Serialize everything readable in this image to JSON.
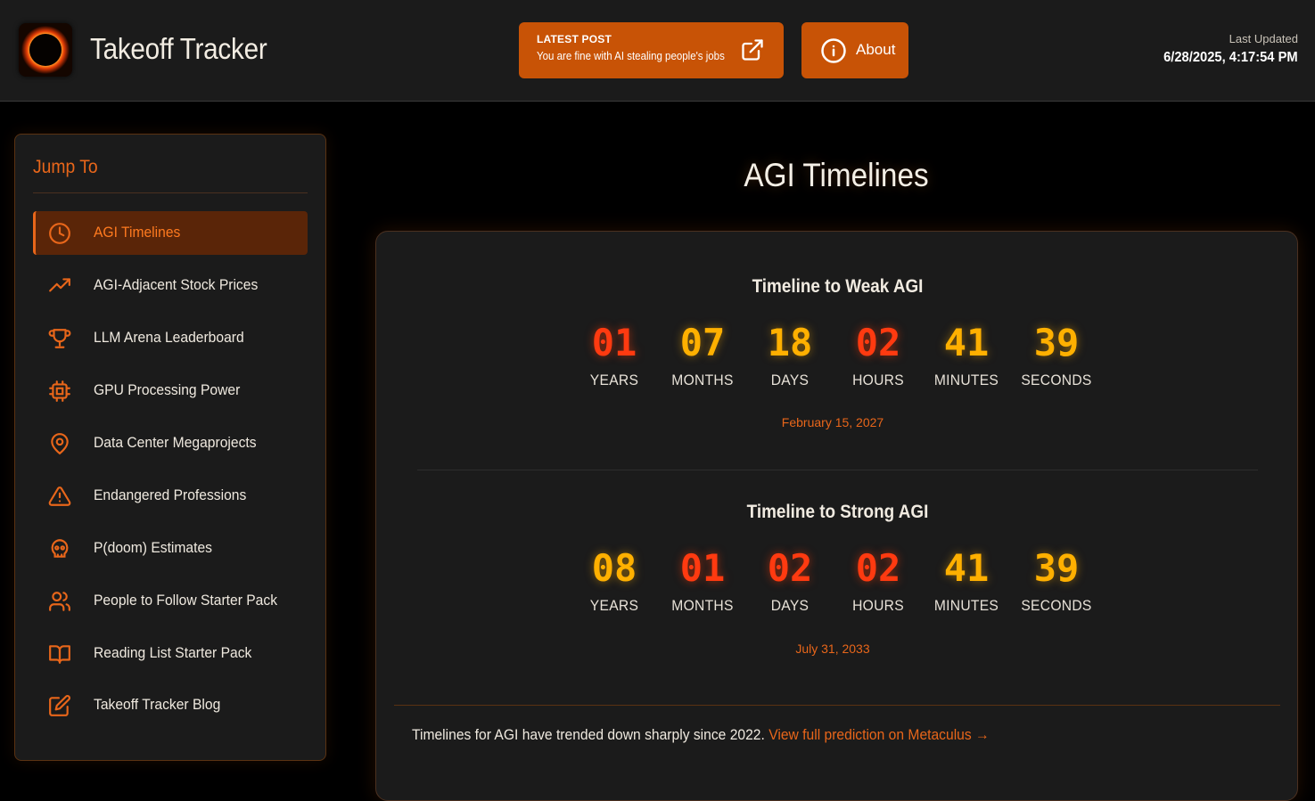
{
  "header": {
    "brand": "Takeoff Tracker",
    "logo_icon": "ring-of-fire-logo",
    "latest_post": {
      "kicker": "LATEST POST",
      "title": "You are fine with AI stealing people's jobs",
      "icon": "external-link-icon"
    },
    "about": {
      "label": "About",
      "icon": "info-icon"
    },
    "last_updated_label": "Last Updated",
    "last_updated_value": "6/28/2025, 4:17:54 PM"
  },
  "sidebar": {
    "title": "Jump To",
    "items": [
      {
        "label": "AGI Timelines",
        "icon": "clock-icon",
        "active": true
      },
      {
        "label": "AGI-Adjacent Stock Prices",
        "icon": "trending-up-icon",
        "active": false
      },
      {
        "label": "LLM Arena Leaderboard",
        "icon": "trophy-icon",
        "active": false
      },
      {
        "label": "GPU Processing Power",
        "icon": "cpu-icon",
        "active": false
      },
      {
        "label": "Data Center Megaprojects",
        "icon": "map-pin-icon",
        "active": false
      },
      {
        "label": "Endangered Professions",
        "icon": "warning-icon",
        "active": false
      },
      {
        "label": "P(doom) Estimates",
        "icon": "skull-icon",
        "active": false
      },
      {
        "label": "People to Follow Starter Pack",
        "icon": "users-icon",
        "active": false
      },
      {
        "label": "Reading List Starter Pack",
        "icon": "book-open-icon",
        "active": false
      },
      {
        "label": "Takeoff Tracker Blog",
        "icon": "edit-icon",
        "active": false
      }
    ]
  },
  "main": {
    "title": "AGI Timelines",
    "timelines": [
      {
        "title": "Timeline to Weak AGI",
        "units": [
          {
            "value": "01",
            "label": "YEARS",
            "color": "#ff3a10"
          },
          {
            "value": "07",
            "label": "MONTHS",
            "color": "#ffb000"
          },
          {
            "value": "18",
            "label": "DAYS",
            "color": "#ffb000"
          },
          {
            "value": "02",
            "label": "HOURS",
            "color": "#ff3a10"
          },
          {
            "value": "41",
            "label": "MINUTES",
            "color": "#ffb000"
          },
          {
            "value": "39",
            "label": "SECONDS",
            "color": "#ffb000"
          }
        ],
        "target_date": "February 15, 2027"
      },
      {
        "title": "Timeline to Strong AGI",
        "units": [
          {
            "value": "08",
            "label": "YEARS",
            "color": "#ffb000"
          },
          {
            "value": "01",
            "label": "MONTHS",
            "color": "#ff3a10"
          },
          {
            "value": "02",
            "label": "DAYS",
            "color": "#ff3a10"
          },
          {
            "value": "02",
            "label": "HOURS",
            "color": "#ff3a10"
          },
          {
            "value": "41",
            "label": "MINUTES",
            "color": "#ffb000"
          },
          {
            "value": "39",
            "label": "SECONDS",
            "color": "#ffb000"
          }
        ],
        "target_date": "July 31, 2033"
      }
    ],
    "footer_text": "Timelines for AGI have trended down sharply since 2022.",
    "footer_link": "View full prediction on Metaculus →"
  },
  "colors": {
    "accent": "#e8661a",
    "button": "#c85306",
    "countdown_red": "#ff3a10",
    "countdown_amber": "#ffb000"
  }
}
